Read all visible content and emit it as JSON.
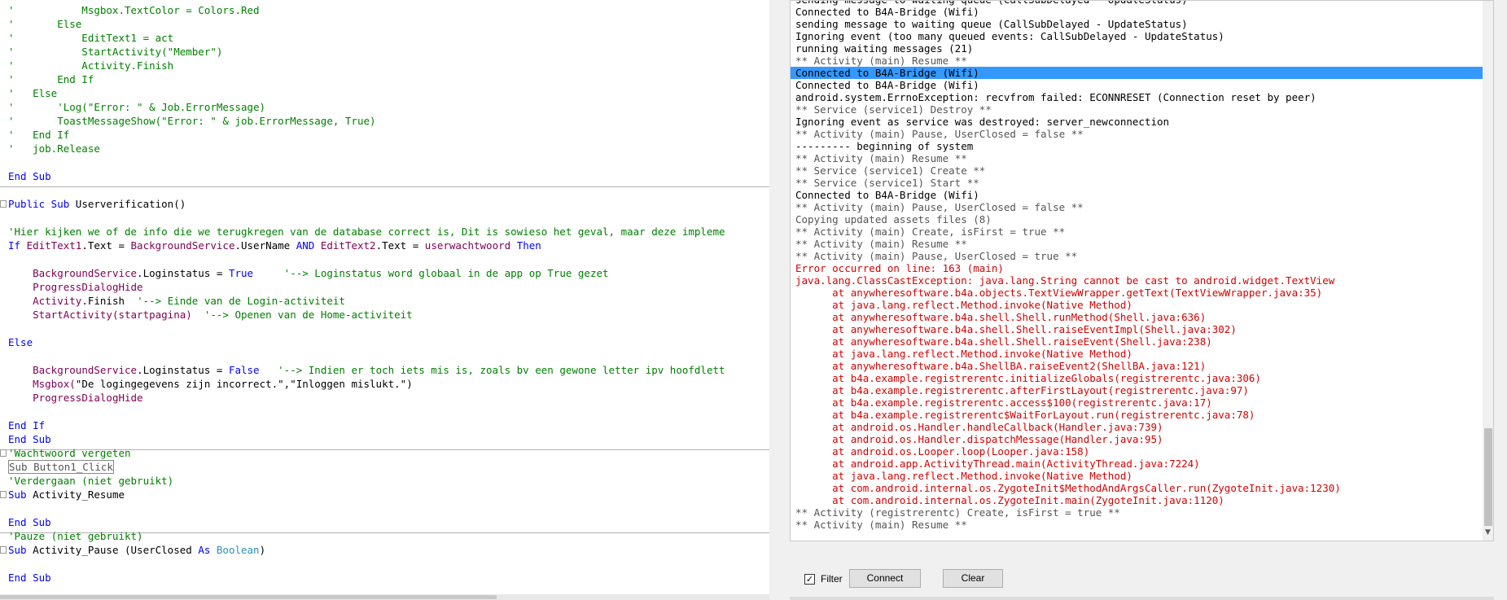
{
  "editor": {
    "lines": [
      {
        "segs": [
          {
            "text": "'           Msgbox.TextColor = Colors.Red",
            "cls": "c"
          }
        ]
      },
      {
        "segs": [
          {
            "text": "'       Else",
            "cls": "c"
          }
        ]
      },
      {
        "segs": [
          {
            "text": "'           EditText1 = act",
            "cls": "c"
          }
        ]
      },
      {
        "segs": [
          {
            "text": "'           StartActivity(\"Member\")",
            "cls": "c"
          }
        ]
      },
      {
        "segs": [
          {
            "text": "'           Activity.Finish",
            "cls": "c"
          }
        ]
      },
      {
        "segs": [
          {
            "text": "'       End If",
            "cls": "c"
          }
        ]
      },
      {
        "segs": [
          {
            "text": "'   Else",
            "cls": "c"
          }
        ]
      },
      {
        "segs": [
          {
            "text": "'       'Log(\"Error: \" & Job.ErrorMessage)",
            "cls": "c"
          }
        ]
      },
      {
        "segs": [
          {
            "text": "'       ToastMessageShow(\"Error: \" & job.ErrorMessage, True)",
            "cls": "c"
          }
        ]
      },
      {
        "segs": [
          {
            "text": "'   End If",
            "cls": "c"
          }
        ]
      },
      {
        "segs": [
          {
            "text": "'   job.Release",
            "cls": "c"
          }
        ]
      },
      {
        "segs": []
      },
      {
        "segs": [
          {
            "text": "End Sub",
            "cls": "k"
          }
        ]
      },
      {
        "segs": []
      },
      {
        "segs": [
          {
            "text": "Public Sub ",
            "cls": "k"
          },
          {
            "text": "Userverification()",
            "cls": ""
          }
        ]
      },
      {
        "segs": []
      },
      {
        "segs": [
          {
            "text": "'Hier kijken we of de info die we terugkregen van de database correct is, Dit is sowieso het geval, maar deze impleme",
            "cls": "c"
          }
        ]
      },
      {
        "segs": [
          {
            "text": "If ",
            "cls": "k"
          },
          {
            "text": "EditText1",
            "cls": "m"
          },
          {
            "text": ".Text = ",
            "cls": ""
          },
          {
            "text": "BackgroundService",
            "cls": "m"
          },
          {
            "text": ".UserName ",
            "cls": ""
          },
          {
            "text": "AND ",
            "cls": "k"
          },
          {
            "text": "EditText2",
            "cls": "m"
          },
          {
            "text": ".Text = ",
            "cls": ""
          },
          {
            "text": "userwachtwoord ",
            "cls": "m"
          },
          {
            "text": "Then",
            "cls": "k"
          }
        ]
      },
      {
        "segs": []
      },
      {
        "segs": [
          {
            "text": "    ",
            "cls": ""
          },
          {
            "text": "BackgroundService",
            "cls": "m"
          },
          {
            "text": ".Loginstatus = ",
            "cls": ""
          },
          {
            "text": "True",
            "cls": "k"
          },
          {
            "text": "     '--> Loginstatus word globaal in de app op True gezet",
            "cls": "c"
          }
        ]
      },
      {
        "segs": [
          {
            "text": "    ",
            "cls": ""
          },
          {
            "text": "ProgressDialogHide",
            "cls": "m"
          }
        ]
      },
      {
        "segs": [
          {
            "text": "    ",
            "cls": ""
          },
          {
            "text": "Activity",
            "cls": "m"
          },
          {
            "text": ".Finish  ",
            "cls": ""
          },
          {
            "text": "'--> Einde van de Login-activiteit",
            "cls": "c"
          }
        ]
      },
      {
        "segs": [
          {
            "text": "    ",
            "cls": ""
          },
          {
            "text": "StartActivity(startpagina)",
            "cls": "m"
          },
          {
            "text": "  '--> Openen van de Home-activiteit",
            "cls": "c"
          }
        ]
      },
      {
        "segs": []
      },
      {
        "segs": [
          {
            "text": "Else",
            "cls": "k"
          }
        ]
      },
      {
        "segs": []
      },
      {
        "segs": [
          {
            "text": "    ",
            "cls": ""
          },
          {
            "text": "BackgroundService",
            "cls": "m"
          },
          {
            "text": ".Loginstatus = ",
            "cls": ""
          },
          {
            "text": "False",
            "cls": "k"
          },
          {
            "text": "   '--> Indien er toch iets mis is, zoals bv een gewone letter ipv hoofdlett",
            "cls": "c"
          }
        ]
      },
      {
        "segs": [
          {
            "text": "    ",
            "cls": ""
          },
          {
            "text": "Msgbox(",
            "cls": "m"
          },
          {
            "text": "\"De logingegevens zijn incorrect.\",\"Inloggen mislukt.\"",
            "cls": ""
          },
          {
            "text": ")",
            "cls": ""
          }
        ]
      },
      {
        "segs": [
          {
            "text": "    ",
            "cls": ""
          },
          {
            "text": "ProgressDialogHide",
            "cls": "m"
          }
        ]
      },
      {
        "segs": []
      },
      {
        "segs": [
          {
            "text": "End If",
            "cls": "k"
          }
        ]
      },
      {
        "segs": [
          {
            "text": "End Sub",
            "cls": "k"
          }
        ]
      },
      {
        "segs": [
          {
            "text": "'Wachtwoord vergeten",
            "cls": "c"
          }
        ]
      },
      {
        "segs": [
          {
            "text": "Sub Button1_Click",
            "cls": "boxed"
          }
        ]
      },
      {
        "segs": [
          {
            "text": "'Verdergaan (niet gebruikt)",
            "cls": "c"
          }
        ]
      },
      {
        "segs": [
          {
            "text": "Sub ",
            "cls": "k"
          },
          {
            "text": "Activity_Resume",
            "cls": ""
          }
        ]
      },
      {
        "segs": []
      },
      {
        "segs": [
          {
            "text": "End Sub",
            "cls": "k"
          }
        ]
      },
      {
        "segs": [
          {
            "text": "'Pauze (niet gebruikt)",
            "cls": "c"
          }
        ]
      },
      {
        "segs": [
          {
            "text": "Sub ",
            "cls": "k"
          },
          {
            "text": "Activity_Pause (UserClosed ",
            "cls": ""
          },
          {
            "text": "As ",
            "cls": "k"
          },
          {
            "text": "Boolean",
            "cls": "t"
          },
          {
            "text": ")",
            "cls": ""
          }
        ]
      },
      {
        "segs": []
      },
      {
        "segs": [
          {
            "text": "End Sub",
            "cls": "k"
          }
        ]
      }
    ]
  },
  "log": {
    "lines": [
      {
        "text": "sending message to waiting queue (CallSubDelayed - UpdateStatus)",
        "style": "black"
      },
      {
        "text": "Connected to B4A-Bridge (Wifi)",
        "style": "black"
      },
      {
        "text": "sending message to waiting queue (CallSubDelayed - UpdateStatus)",
        "style": "black"
      },
      {
        "text": "Ignoring event (too many queued events: CallSubDelayed - UpdateStatus)",
        "style": "black"
      },
      {
        "text": "running waiting messages (21)",
        "style": "black"
      },
      {
        "text": "** Activity (main) Resume **",
        "style": "gray"
      },
      {
        "text": "Connected to B4A-Bridge (Wifi)",
        "style": "selected"
      },
      {
        "text": "Connected to B4A-Bridge (Wifi)",
        "style": "black"
      },
      {
        "text": "android.system.ErrnoException: recvfrom failed: ECONNRESET (Connection reset by peer)",
        "style": "black"
      },
      {
        "text": "** Service (service1) Destroy **",
        "style": "gray"
      },
      {
        "text": "Ignoring event as service was destroyed: server_newconnection",
        "style": "black"
      },
      {
        "text": "** Activity (main) Pause, UserClosed = false **",
        "style": "gray"
      },
      {
        "text": "--------- beginning of system",
        "style": "black"
      },
      {
        "text": "** Activity (main) Resume **",
        "style": "gray"
      },
      {
        "text": "** Service (service1) Create **",
        "style": "gray"
      },
      {
        "text": "** Service (service1) Start **",
        "style": "gray"
      },
      {
        "text": "Connected to B4A-Bridge (Wifi)",
        "style": "black"
      },
      {
        "text": "** Activity (main) Pause, UserClosed = false **",
        "style": "gray"
      },
      {
        "text": "Copying updated assets files (8)",
        "style": "gray"
      },
      {
        "text": "** Activity (main) Create, isFirst = true **",
        "style": "gray"
      },
      {
        "text": "** Activity (main) Resume **",
        "style": "gray"
      },
      {
        "text": "** Activity (main) Pause, UserClosed = true **",
        "style": "gray"
      },
      {
        "text": "Error occurred on line: 163 (main)",
        "style": "red"
      },
      {
        "text": "java.lang.ClassCastException: java.lang.String cannot be cast to android.widget.TextView",
        "style": "red"
      },
      {
        "text": "      at anywheresoftware.b4a.objects.TextViewWrapper.getText(TextViewWrapper.java:35)",
        "style": "red"
      },
      {
        "text": "      at java.lang.reflect.Method.invoke(Native Method)",
        "style": "red"
      },
      {
        "text": "      at anywheresoftware.b4a.shell.Shell.runMethod(Shell.java:636)",
        "style": "red"
      },
      {
        "text": "      at anywheresoftware.b4a.shell.Shell.raiseEventImpl(Shell.java:302)",
        "style": "red"
      },
      {
        "text": "      at anywheresoftware.b4a.shell.Shell.raiseEvent(Shell.java:238)",
        "style": "red"
      },
      {
        "text": "      at java.lang.reflect.Method.invoke(Native Method)",
        "style": "red"
      },
      {
        "text": "      at anywheresoftware.b4a.ShellBA.raiseEvent2(ShellBA.java:121)",
        "style": "red"
      },
      {
        "text": "      at b4a.example.registrerentc.initializeGlobals(registrerentc.java:306)",
        "style": "red"
      },
      {
        "text": "      at b4a.example.registrerentc.afterFirstLayout(registrerentc.java:97)",
        "style": "red"
      },
      {
        "text": "      at b4a.example.registrerentc.access$100(registrerentc.java:17)",
        "style": "red"
      },
      {
        "text": "      at b4a.example.registrerentc$WaitForLayout.run(registrerentc.java:78)",
        "style": "red"
      },
      {
        "text": "      at android.os.Handler.handleCallback(Handler.java:739)",
        "style": "red"
      },
      {
        "text": "      at android.os.Handler.dispatchMessage(Handler.java:95)",
        "style": "red"
      },
      {
        "text": "      at android.os.Looper.loop(Looper.java:158)",
        "style": "red"
      },
      {
        "text": "      at android.app.ActivityThread.main(ActivityThread.java:7224)",
        "style": "red"
      },
      {
        "text": "      at java.lang.reflect.Method.invoke(Native Method)",
        "style": "red"
      },
      {
        "text": "      at com.android.internal.os.ZygoteInit$MethodAndArgsCaller.run(ZygoteInit.java:1230)",
        "style": "red"
      },
      {
        "text": "      at com.android.internal.os.ZygoteInit.main(ZygoteInit.java:1120)",
        "style": "red"
      },
      {
        "text": "** Activity (registrerentc) Create, isFirst = true **",
        "style": "gray"
      },
      {
        "text": "** Activity (main) Resume **",
        "style": "gray"
      }
    ]
  },
  "controls": {
    "filter_label": "Filter",
    "filter_checked": true,
    "connect_label": "Connect",
    "clear_label": "Clear"
  },
  "icons": {
    "scroll_up": "scroll-up-arrow-icon",
    "scroll_down": "scroll-down-arrow-icon",
    "scroll_left": "scroll-left-arrow-icon",
    "scroll_right": "scroll-right-arrow-icon",
    "check": "checkmark-icon"
  }
}
